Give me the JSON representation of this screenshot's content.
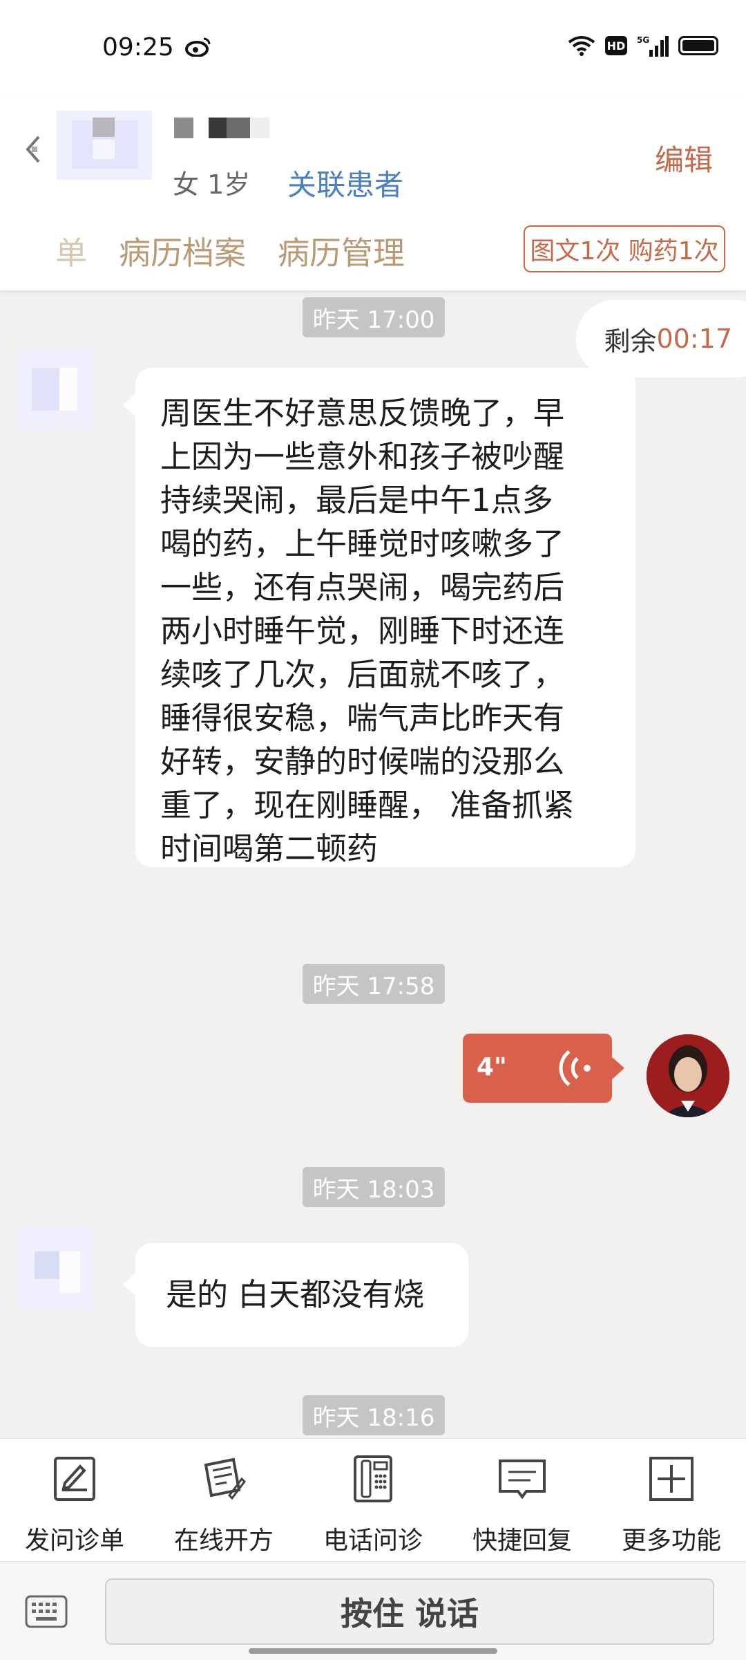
{
  "status_bar": {
    "time": "09:25",
    "network": "5G",
    "hd": "HD",
    "icons": [
      "weibo-icon",
      "wifi-icon",
      "hd-icon",
      "signal-icon",
      "battery-icon"
    ]
  },
  "header": {
    "gender_age": "女 1岁",
    "link_patient": "关联患者",
    "edit": "编辑",
    "tabs": [
      "问诊单",
      "病历档案",
      "病历管理"
    ],
    "tab_visible": [
      "单",
      "病历档案",
      "病历管理"
    ],
    "badge": "图文1次 购药1次"
  },
  "chat": {
    "remaining_label": "剩余",
    "remaining_count": "00:17",
    "messages": [
      {
        "timestamp": "昨天 17:00",
        "sender": "patient",
        "text": "周医生不好意思反馈晚了，早\n上因为一些意外和孩子被吵醒\n持续哭闹，最后是中午1点多\n喝的药，上午睡觉时咳嗽多了\n一些，还有点哭闹，喝完药后\n两小时睡午觉，刚睡下时还连\n续咳了几次，后面就不咳了，\n睡得很安稳，喘气声比昨天有\n好转，安静的时候喘的没那么\n重了，现在刚睡醒， 准备抓紧\n时间喝第二顿药"
      },
      {
        "timestamp": "昨天 17:58",
        "sender": "doctor",
        "type": "voice",
        "duration": "4\""
      },
      {
        "timestamp": "昨天 18:03",
        "sender": "patient",
        "text": "是的 白天都没有烧"
      },
      {
        "timestamp": "昨天 18:16"
      }
    ]
  },
  "toolbar": {
    "items": [
      {
        "label": "发问诊单",
        "icon": "form-edit-icon"
      },
      {
        "label": "在线开方",
        "icon": "prescription-icon"
      },
      {
        "label": "电话问诊",
        "icon": "phone-icon"
      },
      {
        "label": "快捷回复",
        "icon": "quick-reply-icon"
      },
      {
        "label": "更多功能",
        "icon": "plus-icon"
      }
    ]
  },
  "input": {
    "talk_label": "按住 说话"
  },
  "colors": {
    "accent": "#c46a4a",
    "link": "#4a7fc1",
    "tab": "#b99a75",
    "voice_bubble": "#d9614c"
  }
}
